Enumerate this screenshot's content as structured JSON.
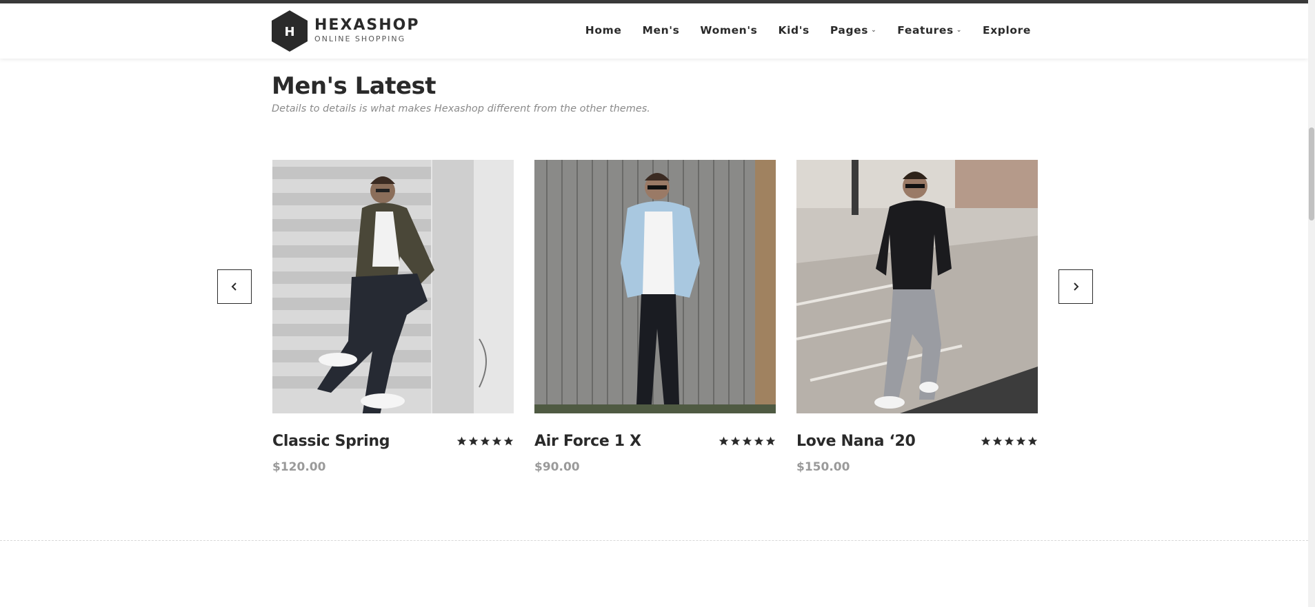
{
  "brand": {
    "logo_letter": "H",
    "title": "HEXASHOP",
    "subtitle": "ONLINE SHOPPING"
  },
  "nav": {
    "items": [
      {
        "label": "Home"
      },
      {
        "label": "Men's"
      },
      {
        "label": "Women's"
      },
      {
        "label": "Kid's"
      },
      {
        "label": "Pages"
      },
      {
        "label": "Features"
      },
      {
        "label": "Explore"
      }
    ],
    "dropdown_icon": "chevron-down-icon"
  },
  "section": {
    "title": "Men's Latest",
    "subtitle": "Details to details is what makes Hexashop different from the other themes."
  },
  "carousel": {
    "prev_icon": "chevron-left-icon",
    "next_icon": "chevron-right-icon"
  },
  "products": [
    {
      "name": "Classic Spring",
      "price": "$120.00",
      "rating": 5
    },
    {
      "name": "Air Force 1 X",
      "price": "$90.00",
      "rating": 5
    },
    {
      "name": "Love Nana ‘20",
      "price": "$150.00",
      "rating": 5
    }
  ],
  "colors": {
    "text": "#2a2a2a",
    "muted": "#9a9a9a",
    "accent": "#2a2a2a"
  }
}
